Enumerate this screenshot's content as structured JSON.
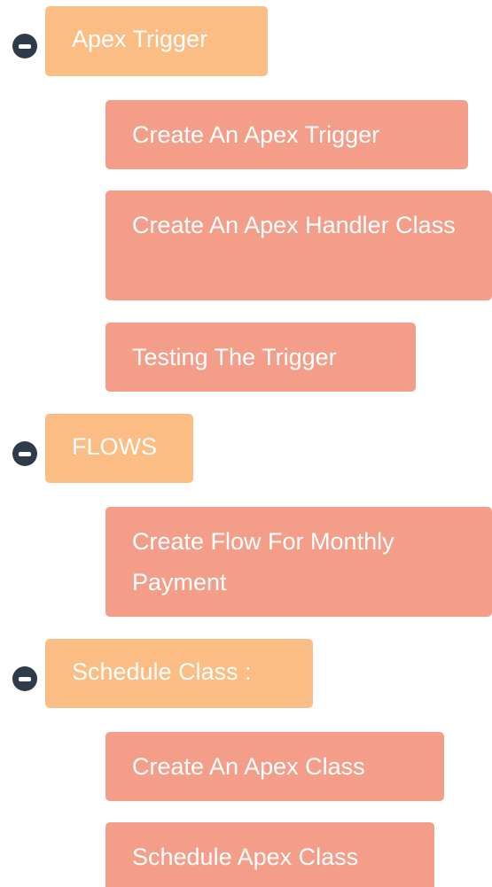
{
  "sections": [
    {
      "title": "Apex Trigger",
      "toggle_icon": "minus-circle-icon",
      "items": [
        "Create An Apex Trigger",
        "Create An Apex Handler Class",
        "Testing The Trigger"
      ]
    },
    {
      "title": "FLOWS",
      "toggle_icon": "minus-circle-icon",
      "items": [
        "Create Flow For Monthly Payment"
      ]
    },
    {
      "title": "Schedule Class :",
      "toggle_icon": "minus-circle-icon",
      "items": [
        "Create An Apex Class",
        "Schedule Apex Class"
      ]
    }
  ],
  "colors": {
    "parent_bg": "#fbbd83",
    "child_bg": "#f49d88",
    "toggle_bg": "#2f3a4a",
    "text": "#ffffff"
  }
}
